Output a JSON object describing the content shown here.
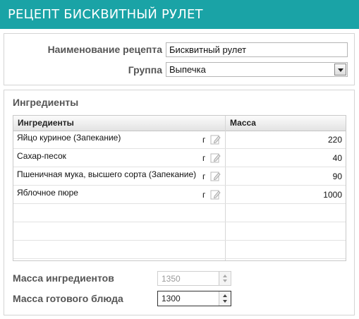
{
  "window": {
    "title": "РЕЦЕПТ БИСКВИТНЫЙ РУЛЕТ"
  },
  "recipe": {
    "name_label": "Наименование рецепта",
    "name_value": "Бисквитный рулет",
    "group_label": "Группа",
    "group_value": "Выпечка"
  },
  "ingredients": {
    "section_title": "Ингредиенты",
    "col_name": "Ингредиенты",
    "col_mass": "Масса",
    "rows": [
      {
        "name": "Яйцо куриное (Запекание)",
        "unit": "г",
        "mass": "220"
      },
      {
        "name": "Сахар-песок",
        "unit": "г",
        "mass": "40"
      },
      {
        "name": "Пшеничная мука, высшего сорта (Запекание)",
        "unit": "г",
        "mass": "90"
      },
      {
        "name": "Яблочное пюре",
        "unit": "г",
        "mass": "1000"
      }
    ]
  },
  "totals": {
    "ingredients_label": "Масса  ингредиентов",
    "ingredients_value": "1350",
    "dish_label": "Масса готового блюда",
    "dish_value": "1300"
  }
}
